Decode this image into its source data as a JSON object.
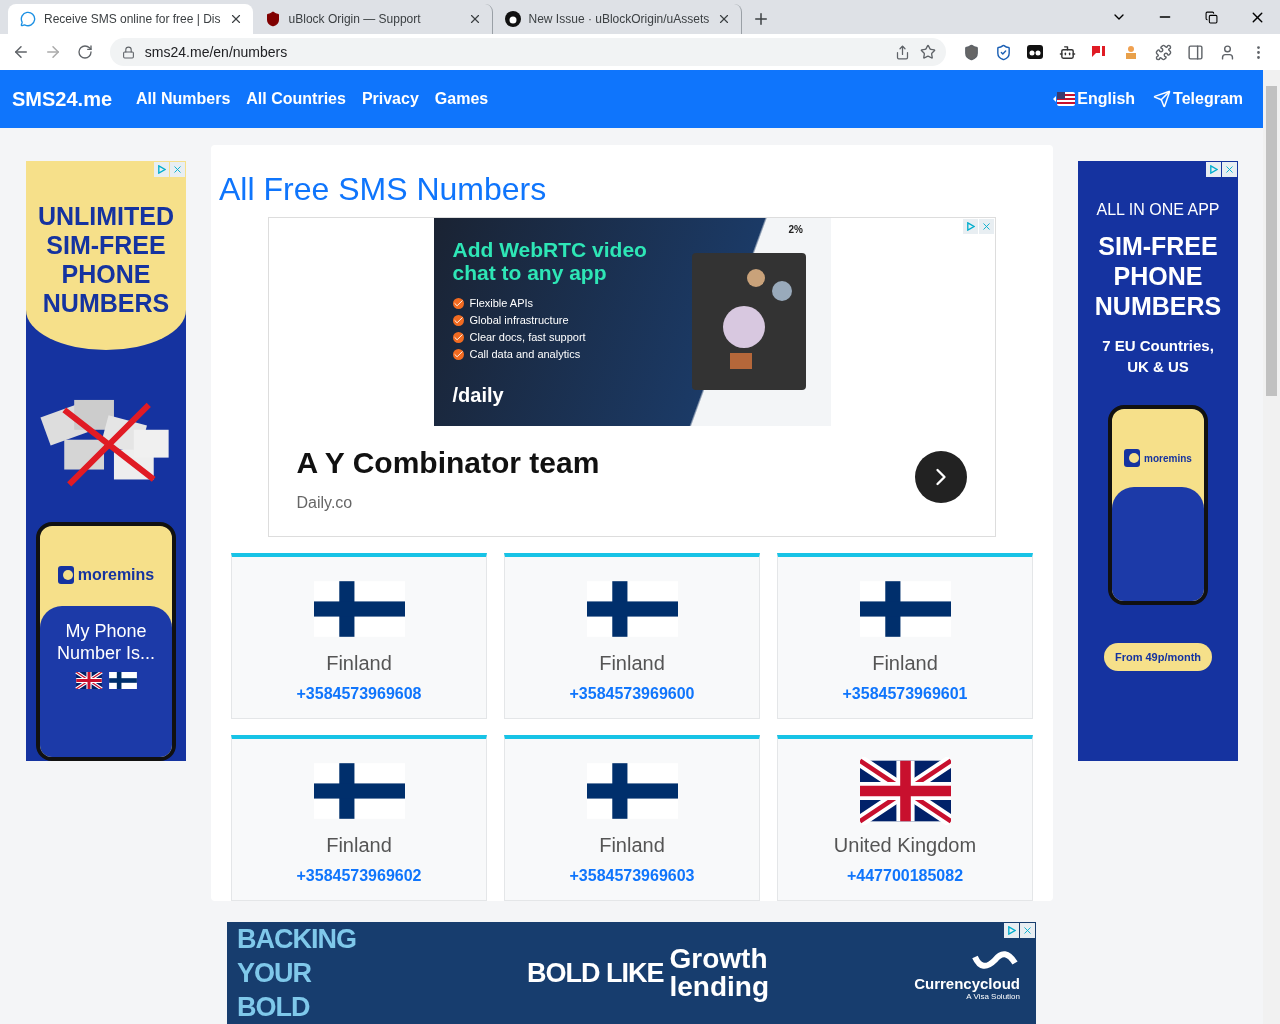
{
  "browser": {
    "tabs": [
      {
        "title": "Receive SMS online for free | Dis",
        "selected": true
      },
      {
        "title": "uBlock Origin — Support",
        "selected": false
      },
      {
        "title": "New Issue · uBlockOrigin/uAssets",
        "selected": false
      }
    ],
    "url": "sms24.me/en/numbers"
  },
  "navbar": {
    "brand": "SMS24.me",
    "links": [
      "All Numbers",
      "All Countries",
      "Privacy",
      "Games"
    ],
    "language": "English",
    "telegram": "Telegram"
  },
  "left_ad": {
    "headline": "UNLIMITED SIM-FREE PHONE NUMBERS",
    "brand": "moremins",
    "phone_text": "My Phone Number Is..."
  },
  "main": {
    "title": "All Free SMS Numbers",
    "ad": {
      "image_headline": "Add WebRTC video chat to any app",
      "bullets": [
        "Flexible APIs",
        "Global infrastructure",
        "Clear docs, fast support",
        "Call data and analytics"
      ],
      "logo": "/daily",
      "stat": "2%",
      "headline": "A Y Combinator team",
      "source": "Daily.co"
    },
    "numbers": [
      {
        "country": "Finland",
        "number": "+3584573969608",
        "kind": "fi"
      },
      {
        "country": "Finland",
        "number": "+3584573969600",
        "kind": "fi"
      },
      {
        "country": "Finland",
        "number": "+3584573969601",
        "kind": "fi"
      },
      {
        "country": "Finland",
        "number": "+3584573969602",
        "kind": "fi"
      },
      {
        "country": "Finland",
        "number": "+3584573969603",
        "kind": "fi"
      },
      {
        "country": "United Kingdom",
        "number": "+447700185082",
        "kind": "gb"
      }
    ]
  },
  "right_ad": {
    "kicker": "ALL IN ONE APP",
    "headline": "SIM-FREE PHONE NUMBERS",
    "subline": "7 EU Countries, UK & US",
    "brand": "moremins",
    "cta": "From 49p/month"
  },
  "bottom_ad": {
    "left": "BACKING YOUR BOLD",
    "middle": "BOLD LIKE",
    "tagline": "Growth lending",
    "brand": "Currencycloud",
    "brand_sub": "A Visa Solution"
  }
}
